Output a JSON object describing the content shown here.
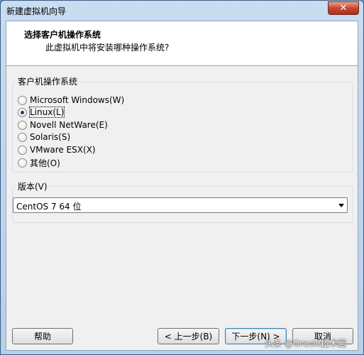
{
  "window": {
    "title": "新建虚拟机向导",
    "close": "✕"
  },
  "header": {
    "title": "选择客户机操作系统",
    "subtitle": "此虚拟机中将安装哪种操作系统?"
  },
  "os_group": {
    "label": "客户机操作系统",
    "options": [
      {
        "label": "Microsoft Windows(W)",
        "checked": false
      },
      {
        "label": "Linux(L)",
        "checked": true
      },
      {
        "label": "Novell NetWare(E)",
        "checked": false
      },
      {
        "label": "Solaris(S)",
        "checked": false
      },
      {
        "label": "VMware ESX(X)",
        "checked": false
      },
      {
        "label": "其他(O)",
        "checked": false
      }
    ]
  },
  "version_group": {
    "label": "版本(V)",
    "selected": "CentOS 7 64 位"
  },
  "buttons": {
    "help": "帮助",
    "back": "< 上一步(B)",
    "next": "下一步(N) >",
    "cancel": "取消"
  },
  "watermark": "头条 @Oracle技术圈"
}
